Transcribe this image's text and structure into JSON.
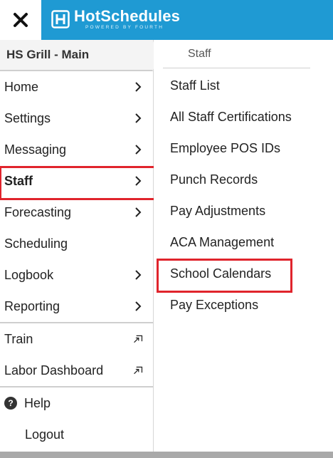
{
  "app": {
    "brand_name": "HotSchedules",
    "brand_tagline": "POWERED BY FOURTH"
  },
  "store": {
    "name": "HS Grill - Main"
  },
  "nav": {
    "items": [
      {
        "label": "Home"
      },
      {
        "label": "Settings"
      },
      {
        "label": "Messaging"
      },
      {
        "label": "Staff"
      },
      {
        "label": "Forecasting"
      },
      {
        "label": "Scheduling"
      },
      {
        "label": "Logbook"
      },
      {
        "label": "Reporting"
      }
    ],
    "external": [
      {
        "label": "Train"
      },
      {
        "label": "Labor Dashboard"
      }
    ],
    "help_label": "Help",
    "help_glyph": "?",
    "logout_label": "Logout"
  },
  "submenu": {
    "title": "Staff",
    "items": [
      {
        "label": "Staff List"
      },
      {
        "label": "All Staff Certifications"
      },
      {
        "label": "Employee POS IDs"
      },
      {
        "label": "Punch Records"
      },
      {
        "label": "Pay Adjustments"
      },
      {
        "label": "ACA Management"
      },
      {
        "label": "School Calendars"
      },
      {
        "label": "Pay Exceptions"
      }
    ]
  },
  "colors": {
    "header_blue": "#1f9ad3",
    "highlight_red": "#e0242c"
  }
}
